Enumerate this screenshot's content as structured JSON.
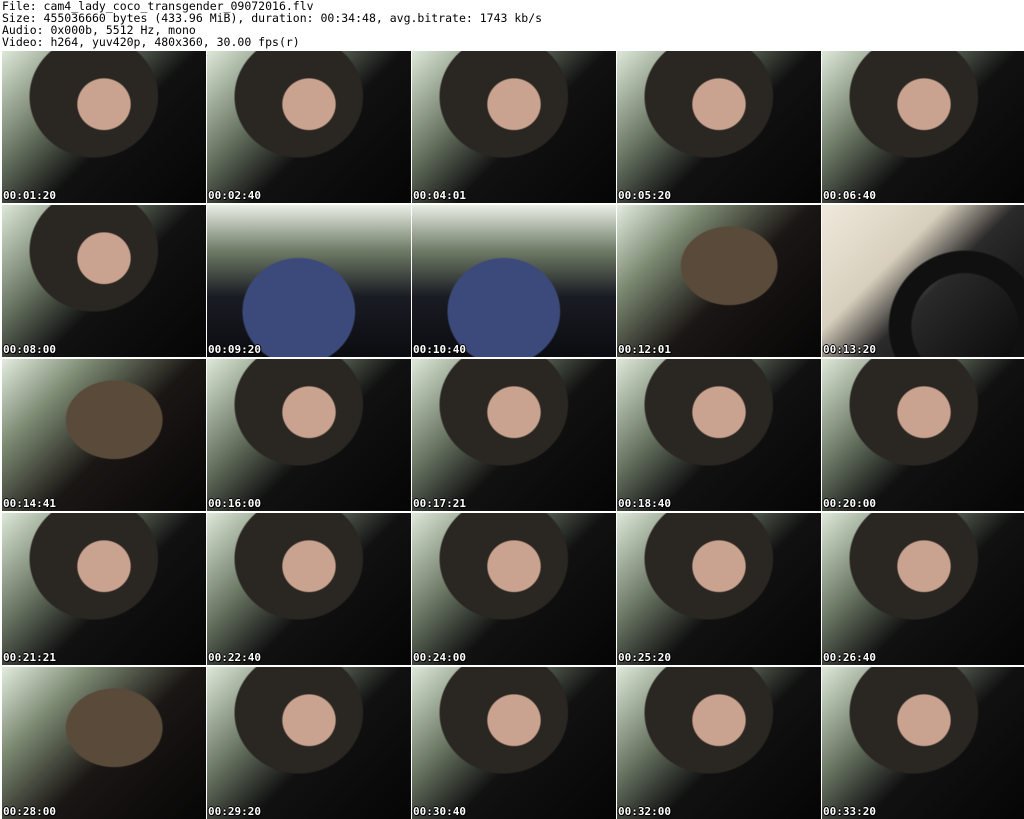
{
  "header": {
    "file": "File: cam4_lady_coco_transgender_09072016.flv",
    "size": "Size: 455036660 bytes (433.96 MiB), duration: 00:34:48, avg.bitrate: 1743 kb/s",
    "audio": "Audio: 0x000b, 5512 Hz, mono",
    "video": "Video: h264, yuv420p, 480x360, 30.00 fps(r)"
  },
  "thumbnails": [
    {
      "time": "00:01:20",
      "scene": "face"
    },
    {
      "time": "00:02:40",
      "scene": "face"
    },
    {
      "time": "00:04:01",
      "scene": "face"
    },
    {
      "time": "00:05:20",
      "scene": "face"
    },
    {
      "time": "00:06:40",
      "scene": "face"
    },
    {
      "time": "00:08:00",
      "scene": "face"
    },
    {
      "time": "00:09:20",
      "scene": "seat"
    },
    {
      "time": "00:10:40",
      "scene": "seat"
    },
    {
      "time": "00:12:01",
      "scene": "hair"
    },
    {
      "time": "00:13:20",
      "scene": "wheel"
    },
    {
      "time": "00:14:41",
      "scene": "hair"
    },
    {
      "time": "00:16:00",
      "scene": "face"
    },
    {
      "time": "00:17:21",
      "scene": "face"
    },
    {
      "time": "00:18:40",
      "scene": "face"
    },
    {
      "time": "00:20:00",
      "scene": "face"
    },
    {
      "time": "00:21:21",
      "scene": "face"
    },
    {
      "time": "00:22:40",
      "scene": "face"
    },
    {
      "time": "00:24:00",
      "scene": "face"
    },
    {
      "time": "00:25:20",
      "scene": "face"
    },
    {
      "time": "00:26:40",
      "scene": "face"
    },
    {
      "time": "00:28:00",
      "scene": "hair"
    },
    {
      "time": "00:29:20",
      "scene": "face"
    },
    {
      "time": "00:30:40",
      "scene": "face"
    },
    {
      "time": "00:32:00",
      "scene": "face"
    },
    {
      "time": "00:33:20",
      "scene": "face"
    }
  ]
}
